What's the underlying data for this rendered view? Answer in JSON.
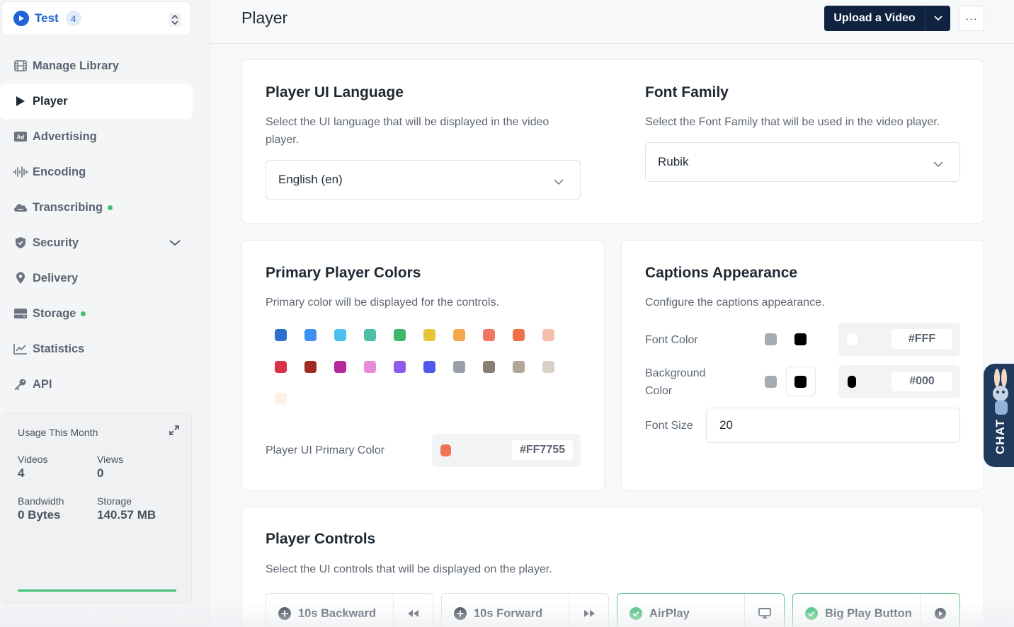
{
  "library": {
    "name": "Test",
    "count": "4"
  },
  "nav": [
    {
      "label": "Manage Library",
      "icon": "film-icon"
    },
    {
      "label": "Player",
      "icon": "play-icon",
      "active": true
    },
    {
      "label": "Advertising",
      "icon": "ad-icon"
    },
    {
      "label": "Encoding",
      "icon": "waveform-icon"
    },
    {
      "label": "Transcribing",
      "icon": "cloud-icon",
      "dot": true
    },
    {
      "label": "Security",
      "icon": "shield-icon",
      "expandable": true
    },
    {
      "label": "Delivery",
      "icon": "location-pin-icon"
    },
    {
      "label": "Storage",
      "icon": "storage-icon",
      "dot": true
    },
    {
      "label": "Statistics",
      "icon": "chart-line-icon"
    },
    {
      "label": "API",
      "icon": "key-icon"
    }
  ],
  "usage": {
    "title": "Usage This Month",
    "videos_label": "Videos",
    "videos_value": "4",
    "views_label": "Views",
    "views_value": "0",
    "bandwidth_label": "Bandwidth",
    "bandwidth_value": "0 Bytes",
    "storage_label": "Storage",
    "storage_value": "140.57 MB"
  },
  "header": {
    "title": "Player",
    "upload_label": "Upload a Video",
    "more_label": "···"
  },
  "language": {
    "title": "Player UI Language",
    "desc_line1": "Select the UI language that will be displayed in the video",
    "desc_line2": "player.",
    "value": "English (en)"
  },
  "font_family": {
    "title": "Font Family",
    "desc": "Select the Font Family that will be used in the video player.",
    "value": "Rubik"
  },
  "colors": {
    "title": "Primary Player Colors",
    "desc": "Primary color will be displayed for the controls.",
    "swatches": [
      "#2f6fcf",
      "#3e8ff0",
      "#4cc0f0",
      "#4cbfa6",
      "#3db76a",
      "#e6c537",
      "#f5a84a",
      "#f17560",
      "#ef6f4a",
      "#f4bfae",
      "#d9334a",
      "#a02a24",
      "#b5279a",
      "#e78ad9",
      "#8c5bea",
      "#4e58ea",
      "#9aa0aa",
      "#8a7d71",
      "#b0a597",
      "#d6d0c6",
      "#fdf1e3"
    ],
    "primary_label": "Player UI Primary Color",
    "primary_hex": "#FF7755",
    "primary_chip": "#ef7352"
  },
  "captions": {
    "title": "Captions Appearance",
    "desc": "Configure the captions appearance.",
    "font_color_label": "Font Color",
    "font_color_hex": "#FFF",
    "bg_label_line1": "Background",
    "bg_label_line2": "Color",
    "bg_color_hex": "#000",
    "font_size_label": "Font Size",
    "font_size_value": "20"
  },
  "controls": {
    "title": "Player Controls",
    "desc": "Select the UI controls that will be displayed on the player.",
    "items": [
      {
        "label": "10s Backward",
        "enabled": false,
        "icon": "rewind-icon"
      },
      {
        "label": "10s Forward",
        "enabled": false,
        "icon": "fast-forward-icon"
      },
      {
        "label": "AirPlay",
        "enabled": true,
        "icon": "airplay-icon"
      },
      {
        "label": "Big Play Button",
        "enabled": true,
        "icon": "play-circle-icon"
      }
    ]
  },
  "chat": {
    "label": "CHAT"
  }
}
